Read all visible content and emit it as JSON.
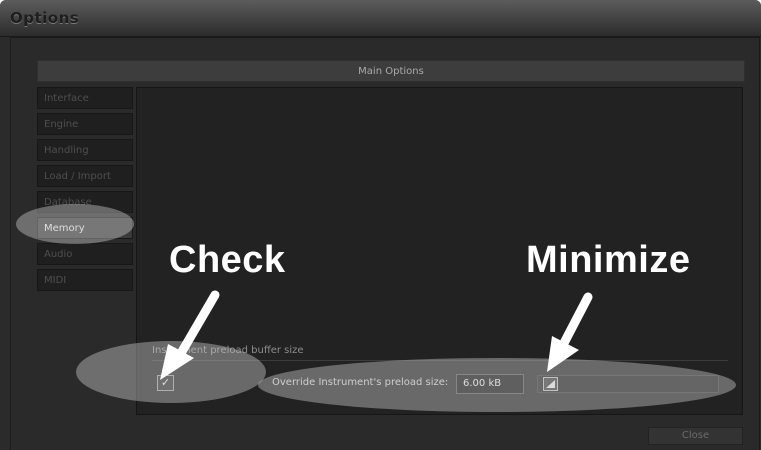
{
  "window": {
    "title": "Options"
  },
  "header": {
    "title": "Main Options"
  },
  "sidebar": {
    "items": [
      {
        "label": "Interface",
        "active": false
      },
      {
        "label": "Engine",
        "active": false
      },
      {
        "label": "Handling",
        "active": false
      },
      {
        "label": "Load / Import",
        "active": false
      },
      {
        "label": "Database",
        "active": false
      },
      {
        "label": "Memory",
        "active": true
      },
      {
        "label": "Audio",
        "active": false
      },
      {
        "label": "MIDI",
        "active": false
      }
    ]
  },
  "memory": {
    "section_label": "Instrument preload buffer size",
    "override_checked": true,
    "override_label": "Override Instrument's preload size:",
    "preload_value": "6.00 kB",
    "slider_level": 0.02
  },
  "footer": {
    "close_label": "Close"
  },
  "annotations": {
    "check_label": "Check",
    "minimize_label": "Minimize",
    "highlight_color": "#cdcdcd",
    "arrow_color": "#ffffff"
  },
  "icons": {
    "checkbox": "checkmark-icon",
    "slider_handle": "slider-handle-icon"
  }
}
